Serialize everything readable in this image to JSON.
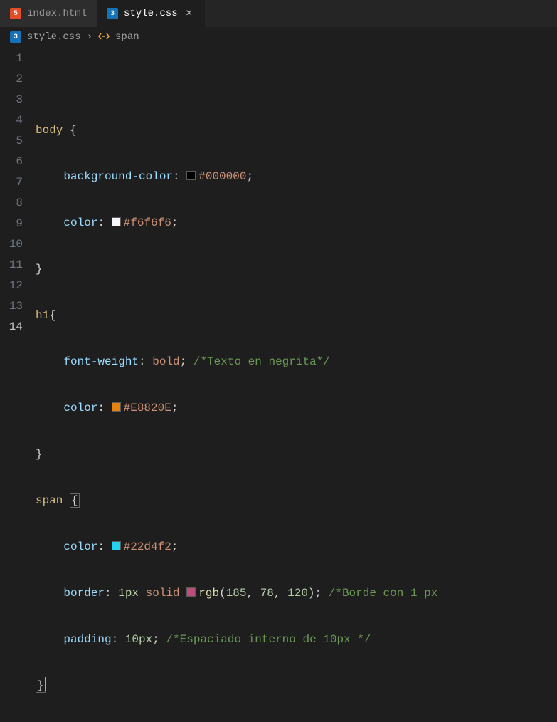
{
  "tabs": [
    {
      "icon": "html5",
      "label": "index.html",
      "active": false,
      "close": false
    },
    {
      "icon": "css3",
      "label": "style.css",
      "active": true,
      "close": true
    }
  ],
  "close_glyph": "×",
  "breadcrumb": {
    "file_icon": "css3",
    "file": "style.css",
    "sep": "›",
    "symbol_icon": "symbol-rule",
    "symbol": "span"
  },
  "gutter": [
    "1",
    "2",
    "3",
    "4",
    "5",
    "6",
    "7",
    "8",
    "9",
    "10",
    "11",
    "12",
    "13",
    "14"
  ],
  "current_line_index": 13,
  "code": {
    "l2": {
      "sel": "body",
      "br": "{"
    },
    "l3": {
      "prop": "background-color",
      "swatch": "#000000",
      "val": "#000000"
    },
    "l4": {
      "prop": "color",
      "swatch": "#f6f6f6",
      "val": "#f6f6f6"
    },
    "l5": {
      "br": "}"
    },
    "l6": {
      "sel": "h1",
      "br": "{"
    },
    "l7": {
      "prop": "font-weight",
      "kw": "bold",
      "cmt": "/*Texto en negrita*/"
    },
    "l8": {
      "prop": "color",
      "swatch": "#E8820E",
      "val": "#E8820E"
    },
    "l9": {
      "br": "}"
    },
    "l10": {
      "sel": "span",
      "space": " ",
      "br": "{"
    },
    "l11": {
      "prop": "color",
      "swatch": "#22d4f2",
      "val": "#22d4f2"
    },
    "l12": {
      "prop": "border",
      "num1": "1px",
      "kw": "solid",
      "swatch": "rgb(185,78,120)",
      "fn": "rgb",
      "args": [
        "185",
        "78",
        "120"
      ],
      "cmt": "/*Borde con 1 px"
    },
    "l13": {
      "prop": "padding",
      "num": "10px",
      "cmt": "/*Espaciado interno de 10px */"
    },
    "l14": {
      "br": "}"
    }
  },
  "icon_text": {
    "html5": "5",
    "css3": "3"
  }
}
